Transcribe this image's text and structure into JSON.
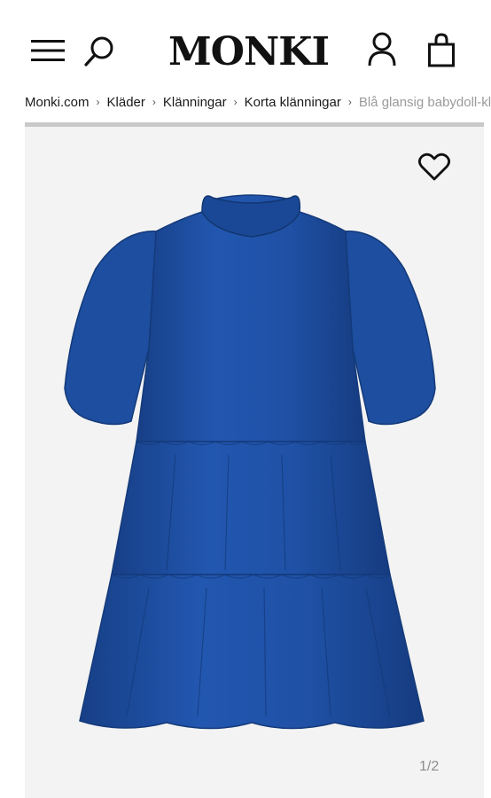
{
  "header": {
    "logo": "MONKI",
    "icons": [
      "menu-icon",
      "search-icon",
      "account-icon",
      "cart-icon"
    ]
  },
  "breadcrumb": [
    {
      "label": "Monki.com"
    },
    {
      "label": "Kläder"
    },
    {
      "label": "Klänningar"
    },
    {
      "label": "Korta klänningar"
    },
    {
      "label": "Blå glansig babydoll-klänning"
    }
  ],
  "product": {
    "image_counter": "1/2",
    "colors": {
      "dress": "#1c4fa3",
      "background": "#f3f3f3"
    }
  }
}
